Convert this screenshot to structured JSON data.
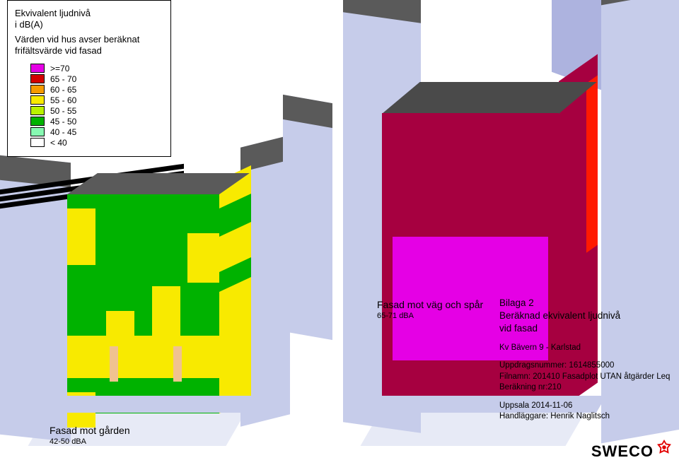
{
  "legend": {
    "title_line1": "Ekvivalent ljudnivå",
    "title_line2": "i dB(A)",
    "subtitle_line1": "Värden vid hus avser beräknat",
    "subtitle_line2": "frifältsvärde vid fasad",
    "rows": [
      {
        "swatch": "sw-magenta",
        "label": " >=70"
      },
      {
        "swatch": "sw-red",
        "label": "65 - 70"
      },
      {
        "swatch": "sw-orange",
        "label": "60 - 65"
      },
      {
        "swatch": "sw-yellow",
        "label": "55 - 60"
      },
      {
        "swatch": "sw-lgreen",
        "label": "50 - 55"
      },
      {
        "swatch": "sw-green",
        "label": "45 - 50"
      },
      {
        "swatch": "sw-mint",
        "label": "40 - 45"
      },
      {
        "swatch": "sw-white",
        "label": "  < 40"
      }
    ]
  },
  "captions": {
    "left_title": "Fasad mot gården",
    "left_value": "42-50 dBA",
    "mid_title": "Fasad mot väg och spår",
    "mid_value": "65-71 dBA"
  },
  "info": {
    "bilaga": "Bilaga 2",
    "desc_line1": "Beräknad ekvivalent ljudnivå",
    "desc_line2": "vid fasad",
    "project": "Kv Bävern 9 - Karlstad",
    "uppdrag": "Uppdragsnummer: 1614855000",
    "filnamn": "Filnamn: 201410 Fasadplot UTAN åtgärder Leq",
    "berakning": "Beräkning nr:210",
    "date": "Uppsala 2014-11-06",
    "handlaggare": "Handläggare: Henrik Naglitsch"
  },
  "logo": {
    "text": "SWECO"
  }
}
